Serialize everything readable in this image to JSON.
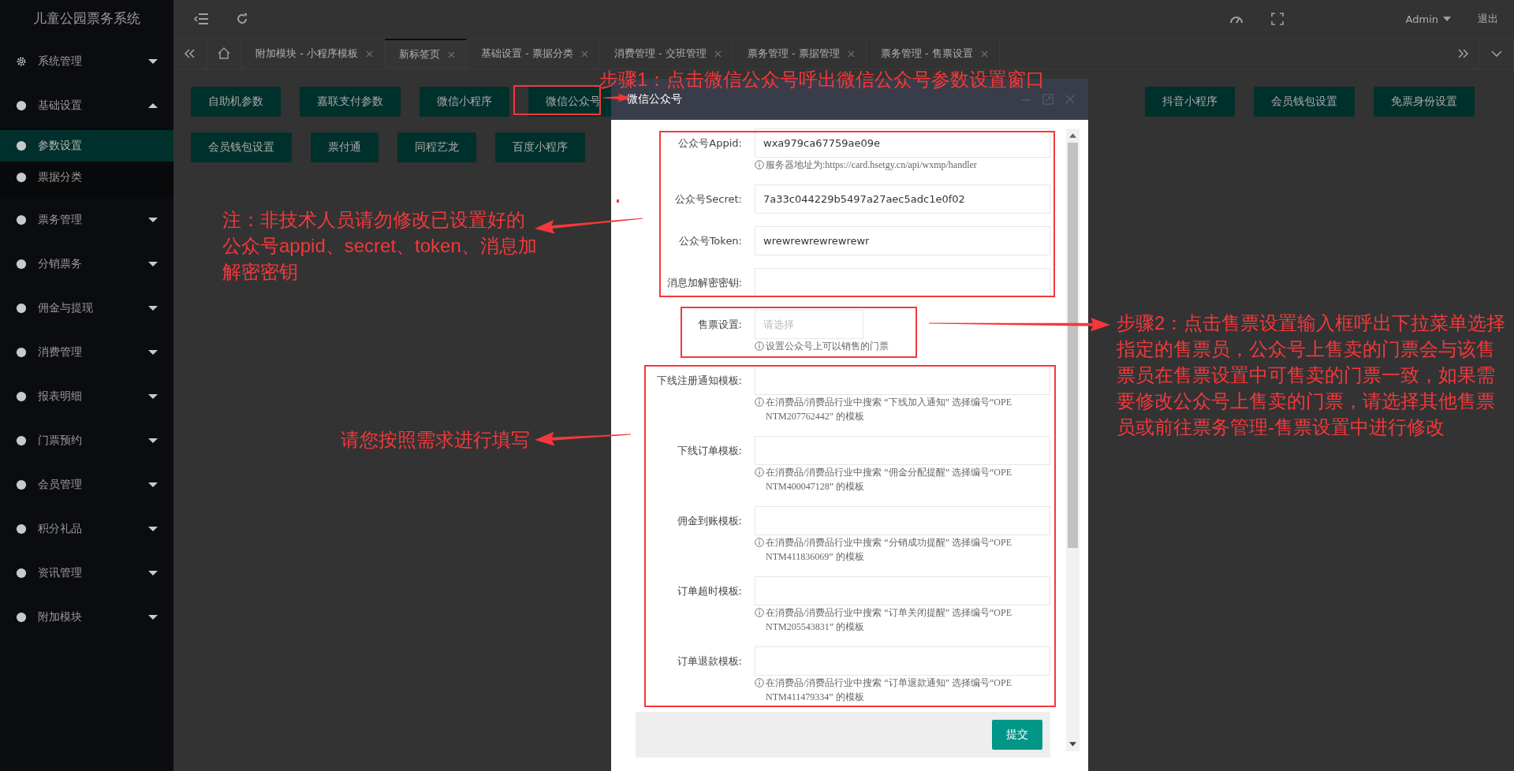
{
  "app_title": "儿童公园票务系统",
  "sidebar": {
    "items": [
      {
        "label": "系统管理",
        "expanded": false
      },
      {
        "label": "基础设置",
        "expanded": true,
        "children": [
          {
            "label": "参数设置",
            "selected": true
          },
          {
            "label": "票据分类",
            "selected": false
          }
        ]
      },
      {
        "label": "票务管理",
        "expanded": false
      },
      {
        "label": "分销票务",
        "expanded": false
      },
      {
        "label": "佣金与提现",
        "expanded": false
      },
      {
        "label": "消费管理",
        "expanded": false
      },
      {
        "label": "报表明细",
        "expanded": false
      },
      {
        "label": "门票预约",
        "expanded": false
      },
      {
        "label": "会员管理",
        "expanded": false
      },
      {
        "label": "积分礼品",
        "expanded": false
      },
      {
        "label": "资讯管理",
        "expanded": false
      },
      {
        "label": "附加模块",
        "expanded": false
      }
    ]
  },
  "header": {
    "user": "Admin",
    "logout": "退出"
  },
  "tabs": [
    {
      "label": "附加模块 - 小程序模板",
      "selected": false
    },
    {
      "label": "新标签页",
      "selected": true
    },
    {
      "label": "基础设置 - 票据分类",
      "selected": false
    },
    {
      "label": "消费管理 - 交班管理",
      "selected": false
    },
    {
      "label": "票务管理 - 票据管理",
      "selected": false
    },
    {
      "label": "票务管理 - 售票设置",
      "selected": false
    }
  ],
  "parameter_buttons": {
    "row_1_left": [
      "自助机参数",
      "嘉联支付参数",
      "微信小程序",
      "微信公众号"
    ],
    "row_1_right": [
      "抖音小程序",
      "会员钱包设置",
      "免票身份设置"
    ],
    "row_2": [
      "会员钱包设置",
      "票付通",
      "同程艺龙",
      "百度小程序"
    ]
  },
  "dialog": {
    "title": "微信公众号",
    "fields": [
      {
        "kind": "text",
        "label": "公众号Appid:",
        "value": "wxa979ca67759ae09e",
        "hint": "服务器地址为:https://card.hsetgy.cn/api/wxmp/handler"
      },
      {
        "kind": "text",
        "label": "公众号Secret:",
        "value": "7a33c044229b5497a27aec5adc1e0f02"
      },
      {
        "kind": "text",
        "label": "公众号Token:",
        "value": "wrewrewrewrewrewr"
      },
      {
        "kind": "text",
        "label": "消息加解密密钥:"
      },
      {
        "kind": "select",
        "label": "售票设置:",
        "placeholder": "请选择",
        "hint": "设置公众号上可以销售的门票"
      },
      {
        "kind": "text",
        "label": "下线注册通知模板:",
        "hint": "在消费品/消费品行业中搜索 “下线加入通知” 选择编号“OPENTM207762442” 的模板"
      },
      {
        "kind": "text",
        "label": "下线订单模板:",
        "hint": "在消费品/消费品行业中搜索 “佣金分配提醒” 选择编号“OPENTM400047128” 的模板"
      },
      {
        "kind": "text",
        "label": "佣金到账模板:",
        "hint": "在消费品/消费品行业中搜索 “分销成功提醒” 选择编号“OPENTM411836069” 的模板"
      },
      {
        "kind": "text",
        "label": "订单超时模板:",
        "hint": "在消费品/消费品行业中搜索 “订单关闭提醒” 选择编号“OPENTM205543831” 的模板"
      },
      {
        "kind": "text",
        "label": "订单退款模板:",
        "hint": "在消费品/消费品行业中搜索 “订单退款通知” 选择编号“OPENTM411479334” 的模板"
      }
    ],
    "submit": "提交"
  },
  "annotations": {
    "step_1": "步骤1：点击微信公众号呼出微信公众号参数设置窗口",
    "note": "注：非技术人员请勿修改已设置好的公众号appid、secret、token、消息加解密密钥",
    "fill_note": "请您按照需求进行填写",
    "step_2": "步骤2：点击售票设置输入框呼出下拉菜单选择指定的售票员，公众号上售卖的门票会与该售票员在售票设置中可售卖的门票一致，如果需要修改公众号上售卖的门票，请选择其他售票员或前往票务管理-售票设置中进行修改"
  }
}
